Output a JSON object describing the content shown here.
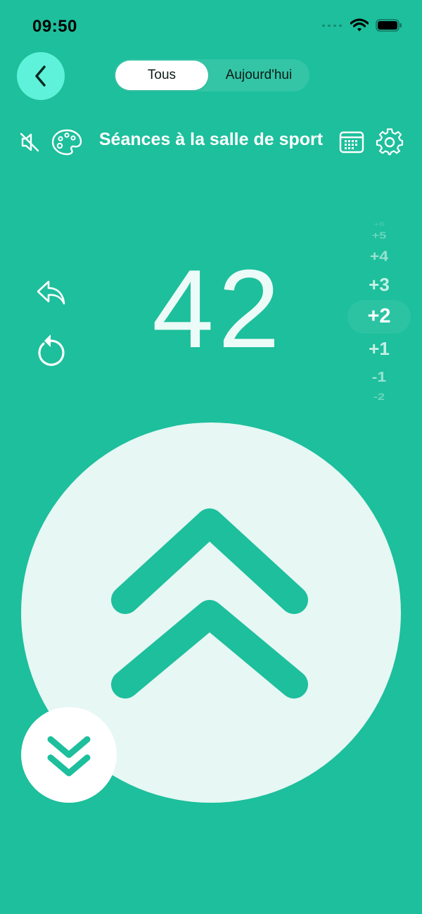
{
  "status_bar": {
    "time": "09:50",
    "icons": [
      "signal-icon",
      "wifi-icon",
      "battery-icon"
    ]
  },
  "nav": {
    "back_icon": "chevron-left-icon",
    "tabs": [
      {
        "label": "Tous",
        "selected": true
      },
      {
        "label": "Aujourd'hui",
        "selected": false
      }
    ]
  },
  "toolbar": {
    "title": "Séances à la salle de sport",
    "left_icons": [
      "speaker-muted-icon",
      "palette-icon"
    ],
    "right_icons": [
      "calendar-icon",
      "gear-icon"
    ]
  },
  "counter": {
    "value": "42",
    "undo_icon": "undo-icon",
    "reset_icon": "reset-icon"
  },
  "step_picker": {
    "options": [
      "+6",
      "+5",
      "+4",
      "+3",
      "+2",
      "+1",
      "-1",
      "-2"
    ],
    "selected": "+2"
  },
  "buttons": {
    "increment_icon": "double-chevron-up-icon",
    "decrement_icon": "double-chevron-down-icon"
  },
  "colors": {
    "background": "#1dbf9c",
    "accent": "#5ff2da",
    "button_face": "#e6f7f4",
    "chevron": "#1dbf9c"
  }
}
